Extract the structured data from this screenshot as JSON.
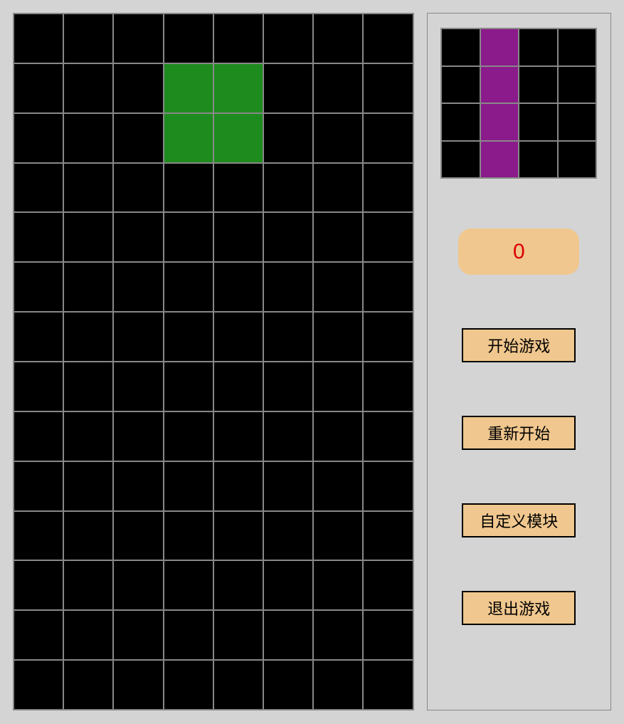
{
  "board": {
    "cols": 8,
    "rows": 14,
    "piece": {
      "color": "green",
      "cells": [
        {
          "row": 1,
          "col": 3
        },
        {
          "row": 1,
          "col": 4
        },
        {
          "row": 2,
          "col": 3
        },
        {
          "row": 2,
          "col": 4
        }
      ]
    }
  },
  "preview": {
    "cols": 4,
    "rows": 4,
    "piece": {
      "color": "purple",
      "cells": [
        {
          "row": 0,
          "col": 1
        },
        {
          "row": 1,
          "col": 1
        },
        {
          "row": 2,
          "col": 1
        },
        {
          "row": 3,
          "col": 1
        }
      ]
    }
  },
  "score": "0",
  "buttons": {
    "start": "开始游戏",
    "restart": "重新开始",
    "custom": "自定义模块",
    "exit": "退出游戏"
  },
  "colors": {
    "green": "#1e8b1e",
    "purple": "#8b1a8b",
    "buttonBg": "#f0c78e",
    "scoreText": "#d00"
  }
}
